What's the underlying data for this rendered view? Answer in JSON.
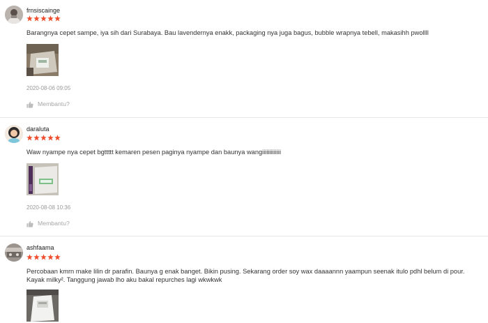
{
  "reviews": [
    {
      "username": "frnsiscainge",
      "rating": 5,
      "comment": "Barangnya cepet sampe, iya sih dari Surabaya. Bau lavendernya enakk, packaging nya juga bagus, bubble wrapnya tebell, makasihh pwollll",
      "timestamp": "2020-08-06 09:05",
      "helpful_label": "Membantu?"
    },
    {
      "username": "daraluta",
      "rating": 5,
      "comment": "Waw nyampe nya cepet bgttttt kemaren pesen paginya nyampe dan baunya wangiiiiiiiiiiiii",
      "timestamp": "2020-08-08 10:36",
      "helpful_label": "Membantu?"
    },
    {
      "username": "ashfaama",
      "rating": 5,
      "comment": "Percobaan kmrn make lilin dr parafin. Baunya g enak banget. Bikin pusing. Sekarang order soy wax daaaannn yaampun seenak itulo pdhl belum di pour. Kayak milky². Tanggung jawab lho aku bakal repurches lagi wkwkwk",
      "timestamp": "",
      "helpful_label": ""
    }
  ],
  "colors": {
    "star": "#ee4d2d",
    "text": "#333333",
    "muted": "#999999",
    "divider": "#e6e6e6"
  },
  "icons": {
    "rating": "star-icon",
    "helpful": "thumbs-up-icon"
  }
}
